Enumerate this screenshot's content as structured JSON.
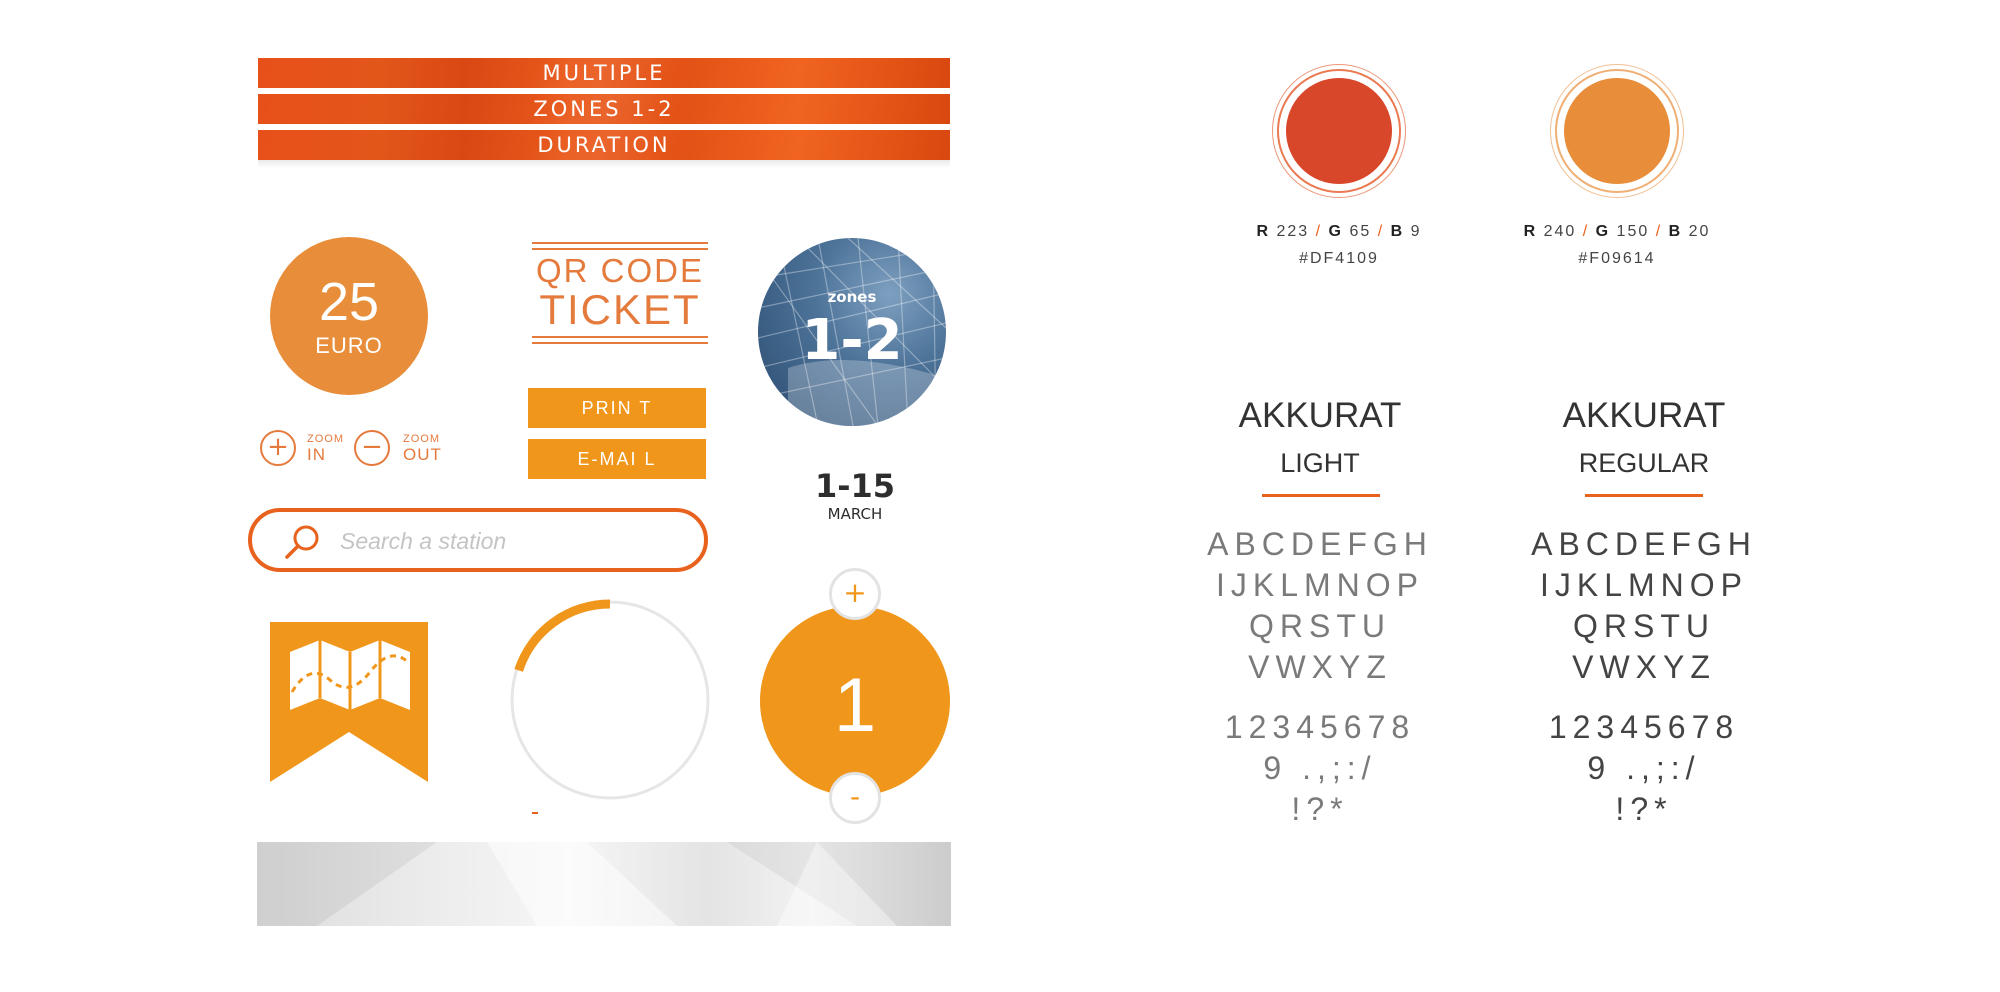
{
  "banners": [
    "MULTIPLE",
    "ZONES 1-2",
    "DURATION"
  ],
  "price": {
    "amount": "25",
    "currency": "EURO"
  },
  "zoom": {
    "in": {
      "symbol": "+",
      "small": "ZOOM",
      "big": "IN"
    },
    "out": {
      "symbol": "−",
      "small": "ZOOM",
      "big": "OUT"
    }
  },
  "qr": {
    "line1": "QR CODE",
    "line2": "TICKET"
  },
  "buttons": {
    "print": "PRIN  T",
    "email": "E-MAI  L"
  },
  "zones": {
    "small": "zones",
    "big": "1-2"
  },
  "date": {
    "range": "1-15",
    "month": "MARCH"
  },
  "search": {
    "placeholder": "Search a station"
  },
  "progress": {
    "fraction": 0.2,
    "track_color": "#e6e6e6",
    "fill_color": "#f0961a"
  },
  "counter": {
    "value": "1",
    "plus": "+",
    "minus": "-"
  },
  "palette": [
    {
      "color": "#DF4109",
      "r_label": "R",
      "r": "223",
      "g_label": "G",
      "g": "65",
      "b_label": "B",
      "b": "9",
      "hex": "#DF4109"
    },
    {
      "color": "#E88D3A",
      "r_label": "R",
      "r": "240",
      "g_label": "G",
      "g": "150",
      "b_label": "B",
      "b": "20",
      "hex": "#F09614"
    }
  ],
  "fonts": [
    {
      "name": "AKKURAT",
      "weight": "LIGHT",
      "rows": [
        "ABCDEFGH",
        "IJKLMNOP",
        "QRSTU",
        "VWXYZ",
        "12345678",
        "9 .,;:/",
        "!?*"
      ]
    },
    {
      "name": "AKKURAT",
      "weight": "REGULAR",
      "rows": [
        "ABCDEFGH",
        "IJKLMNOP",
        "QRSTU",
        "VWXYZ",
        "12345678",
        "9 .,;:/",
        "!?*"
      ]
    }
  ],
  "colors": {
    "accent": "#e8621e",
    "orange": "#f0961a",
    "banner": "#e2561a"
  }
}
